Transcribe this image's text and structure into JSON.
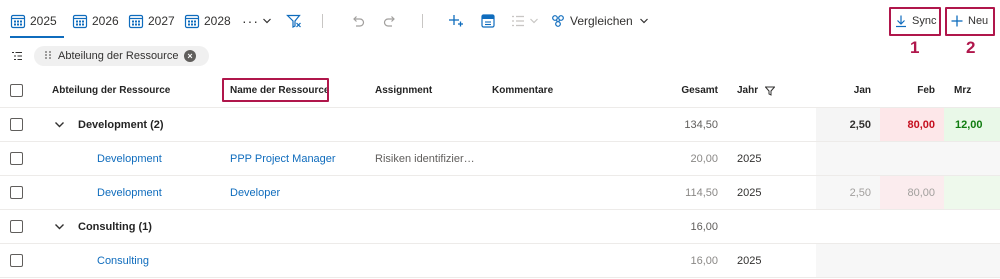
{
  "toolbar": {
    "years": [
      "2025",
      "2026",
      "2027",
      "2028"
    ],
    "more_label": "···",
    "compare_label": "Vergleichen",
    "sync_label": "Sync",
    "new_label": "Neu",
    "callouts": [
      "1",
      "2"
    ]
  },
  "filter": {
    "chip_label": "Abteilung der Ressource",
    "chip_close": "×"
  },
  "grid": {
    "headers": {
      "department": "Abteilung der Ressource",
      "resource_name": "Name der Ressource",
      "assignment": "Assignment",
      "comments": "Kommentare",
      "total": "Gesamt",
      "year": "Jahr",
      "jan": "Jan",
      "feb": "Feb",
      "mar": "Mrz"
    },
    "rows": [
      {
        "type": "group",
        "label": "Development (2)",
        "total": "134,50",
        "jan": "2,50",
        "feb": "80,00",
        "mar": "12,00"
      },
      {
        "type": "item",
        "department": "Development",
        "resource_name": "PPP Project Manager",
        "assignment": "Risiken identifizier…",
        "total": "20,00",
        "year": "2025",
        "jan": "",
        "feb": "",
        "mar": ""
      },
      {
        "type": "item",
        "department": "Development",
        "resource_name": "Developer",
        "assignment": "",
        "total": "114,50",
        "year": "2025",
        "jan": "2,50",
        "feb": "80,00",
        "mar": ""
      },
      {
        "type": "group",
        "label": "Consulting (1)",
        "total": "16,00",
        "jan": "",
        "feb": "",
        "mar": ""
      },
      {
        "type": "item",
        "department": "Consulting",
        "resource_name": "",
        "assignment": "",
        "total": "16,00",
        "year": "2025",
        "jan": "",
        "feb": "",
        "mar": ""
      }
    ]
  },
  "colors": {
    "accent": "#0f6cbd",
    "callout": "#b0164b",
    "over_capacity": "#fde7e9",
    "under_capacity": "#e9f8e8"
  }
}
